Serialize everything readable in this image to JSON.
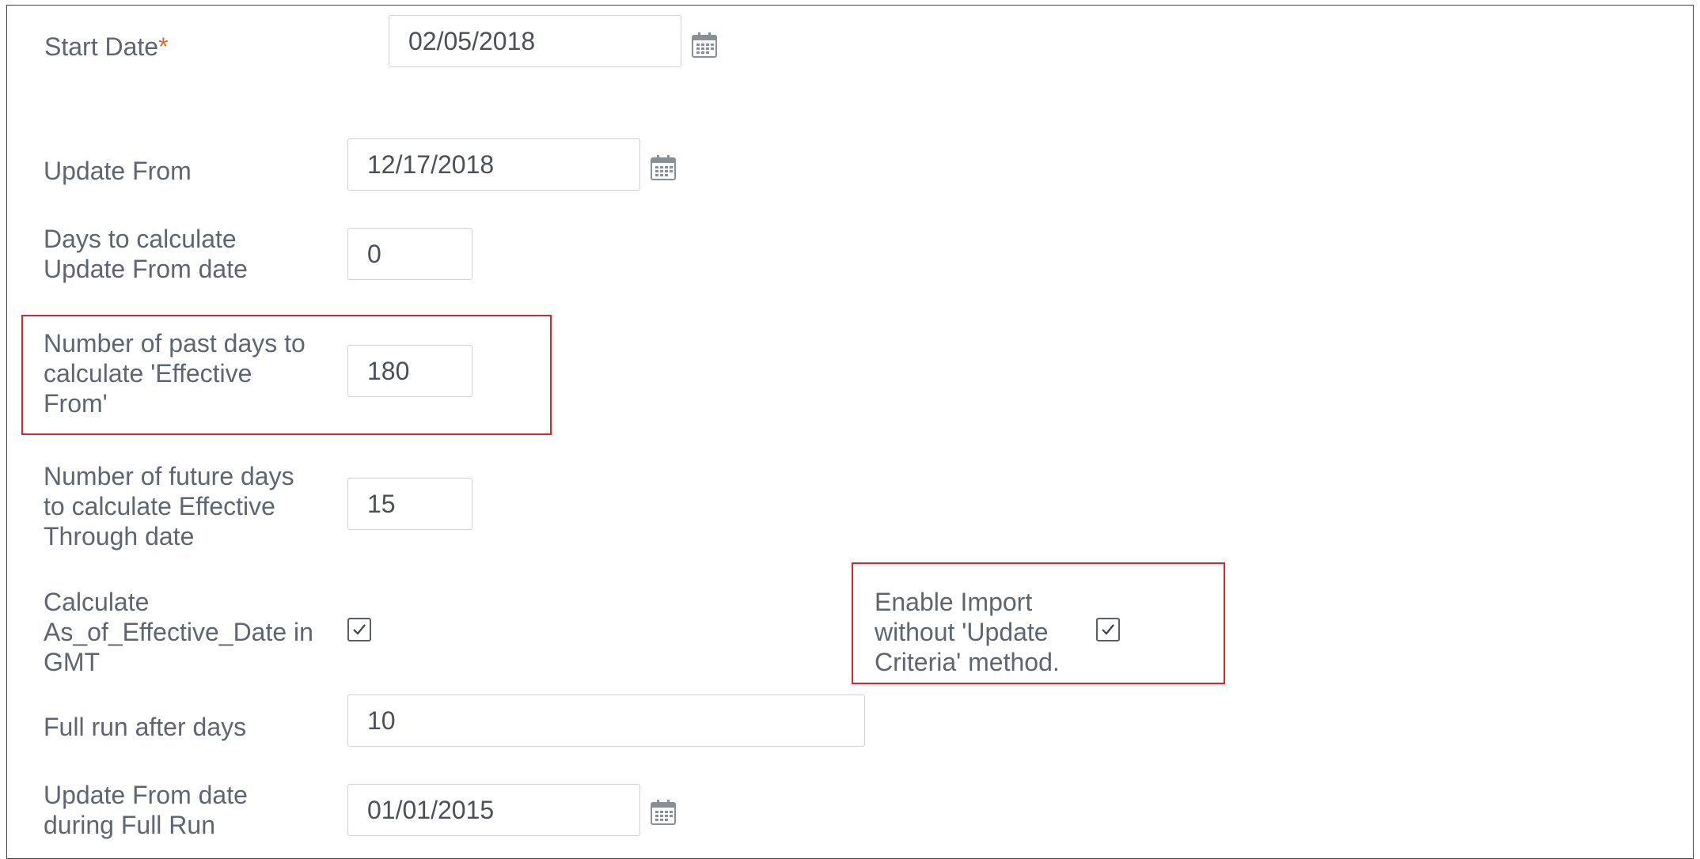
{
  "form": {
    "start_date": {
      "label": "Start Date",
      "required_mark": "*",
      "value": "02/05/2018",
      "icon": "calendar-icon"
    },
    "update_from": {
      "label": "Update From",
      "value": "12/17/2018",
      "icon": "calendar-icon"
    },
    "days_to_calculate": {
      "label_line1": "Days to calculate",
      "label_line2": "Update From date",
      "value": "0"
    },
    "past_days": {
      "label_line1": "Number of past days to",
      "label_line2": "calculate 'Effective",
      "label_line3": "From'",
      "value": "180"
    },
    "future_days": {
      "label_line1": "Number of future days",
      "label_line2": "to calculate Effective",
      "label_line3": "Through date",
      "value": "15"
    },
    "calc_gmt": {
      "label_line1": "Calculate",
      "label_line2": "As_of_Effective_Date in",
      "label_line3": "GMT",
      "checked": true
    },
    "enable_import": {
      "label_line1": "Enable Import",
      "label_line2": "without 'Update",
      "label_line3": "Criteria' method.",
      "checked": true
    },
    "full_run": {
      "label": "Full run after days",
      "value": "10"
    },
    "update_from_full_run": {
      "label_line1": "Update From date",
      "label_line2": "during Full Run",
      "value": "01/01/2015",
      "icon": "calendar-icon"
    }
  },
  "colors": {
    "highlight": "#d9262e",
    "required": "#e06a2e",
    "text": "#5f6570"
  }
}
